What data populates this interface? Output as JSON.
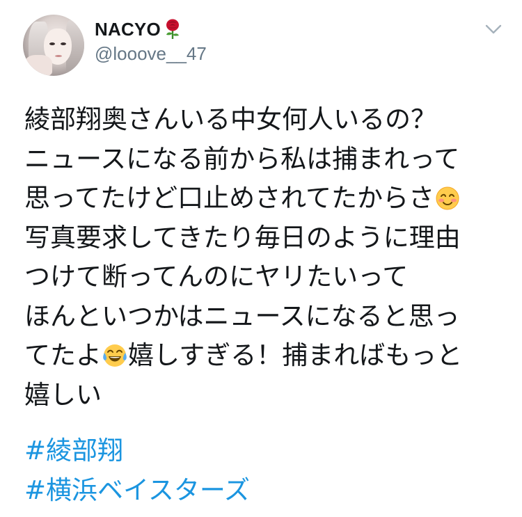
{
  "user": {
    "display_name": "NACYO",
    "name_emoji": "rose-icon",
    "handle": "@looove__47",
    "avatar": "avatar-photo"
  },
  "menu": {
    "icon": "chevron-down-icon"
  },
  "tweet": {
    "lines": [
      {
        "segments": [
          "綾部翔奥さんいる中女何人いるの？"
        ]
      },
      {
        "segments": [
          "ニュースになる前から私は捕まれって"
        ]
      },
      {
        "segments": [
          "思ってたけど口止めされてたからさ"
        ],
        "emoji_after": "smiling-face-icon"
      },
      {
        "segments": [
          "写真要求してきたり毎日のように理由"
        ]
      },
      {
        "segments": [
          "つけて断ってんのにヤリたいって"
        ]
      },
      {
        "segments": [
          "ほんといつかはニュースになると思っ"
        ]
      },
      {
        "segments": [
          "てたよ",
          "嬉しすぎる！捕まればもっと"
        ],
        "emoji_between": "tears-of-joy-icon"
      },
      {
        "segments": [
          "嬉しい"
        ]
      }
    ],
    "hashtags": [
      "#綾部翔",
      "#横浜ベイスターズ"
    ]
  },
  "colors": {
    "text": "#14171a",
    "secondary": "#657786",
    "link": "#1b95e0"
  }
}
